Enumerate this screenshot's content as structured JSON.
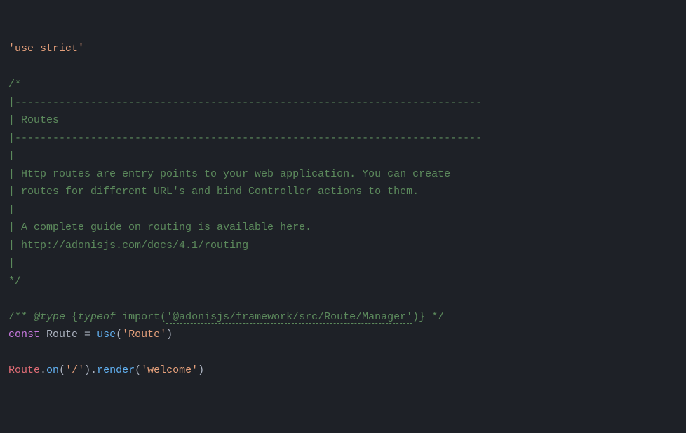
{
  "line1": {
    "str": "'use strict'"
  },
  "comment": {
    "open": "/*",
    "dash1_prefix": "|",
    "dash1": "--------------------------------------------------------------------------",
    "title_prefix": "| ",
    "title": "Routes",
    "dash2_prefix": "|",
    "dash2": "--------------------------------------------------------------------------",
    "pipe1": "|",
    "body1": "| Http routes are entry points to your web application. You can create",
    "body2": "| routes for different URL's and bind Controller actions to them.",
    "pipe2": "|",
    "body3": "| A complete guide on routing is available here.",
    "url_prefix": "| ",
    "url": "http://adonisjs.com/docs/4.1/routing",
    "pipe3": "|",
    "close": "*/"
  },
  "jsdoc": {
    "open": "/** ",
    "at": "@type",
    "brace_open": " {",
    "typeof": "typeof",
    "import_kw": " import",
    "paren_open": "(",
    "import_path": "'@adonisjs/framework/src/Route/Manager'",
    "paren_close": ")",
    "brace_close": "}",
    "close": " */"
  },
  "decl": {
    "const": "const",
    "name": "Route",
    "eq": " = ",
    "use": "use",
    "po": "(",
    "arg": "'Route'",
    "pc": ")"
  },
  "route": {
    "obj": "Route",
    "dot1": ".",
    "on": "on",
    "po1": "(",
    "path": "'/'",
    "pc1": ")",
    "dot2": ".",
    "render": "render",
    "po2": "(",
    "view": "'welcome'",
    "pc2": ")"
  }
}
